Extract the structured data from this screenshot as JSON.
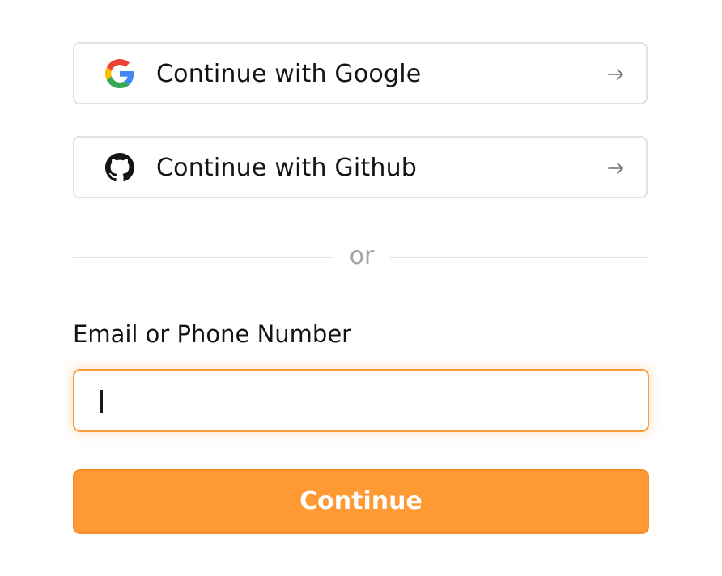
{
  "oauth": {
    "google_label": "Continue with Google",
    "github_label": "Continue with Github",
    "icons": {
      "google": "google-icon",
      "github": "github-icon",
      "arrow": "arrow-right-icon"
    }
  },
  "divider": {
    "text": "or"
  },
  "login_form": {
    "field_label": "Email or Phone Number",
    "field_value": "",
    "submit_label": "Continue"
  },
  "colors": {
    "accent": "#fe9934",
    "accent_border": "#f58d28",
    "text": "#141414",
    "muted": "#a4a4a4",
    "border": "#e2e2e2"
  }
}
